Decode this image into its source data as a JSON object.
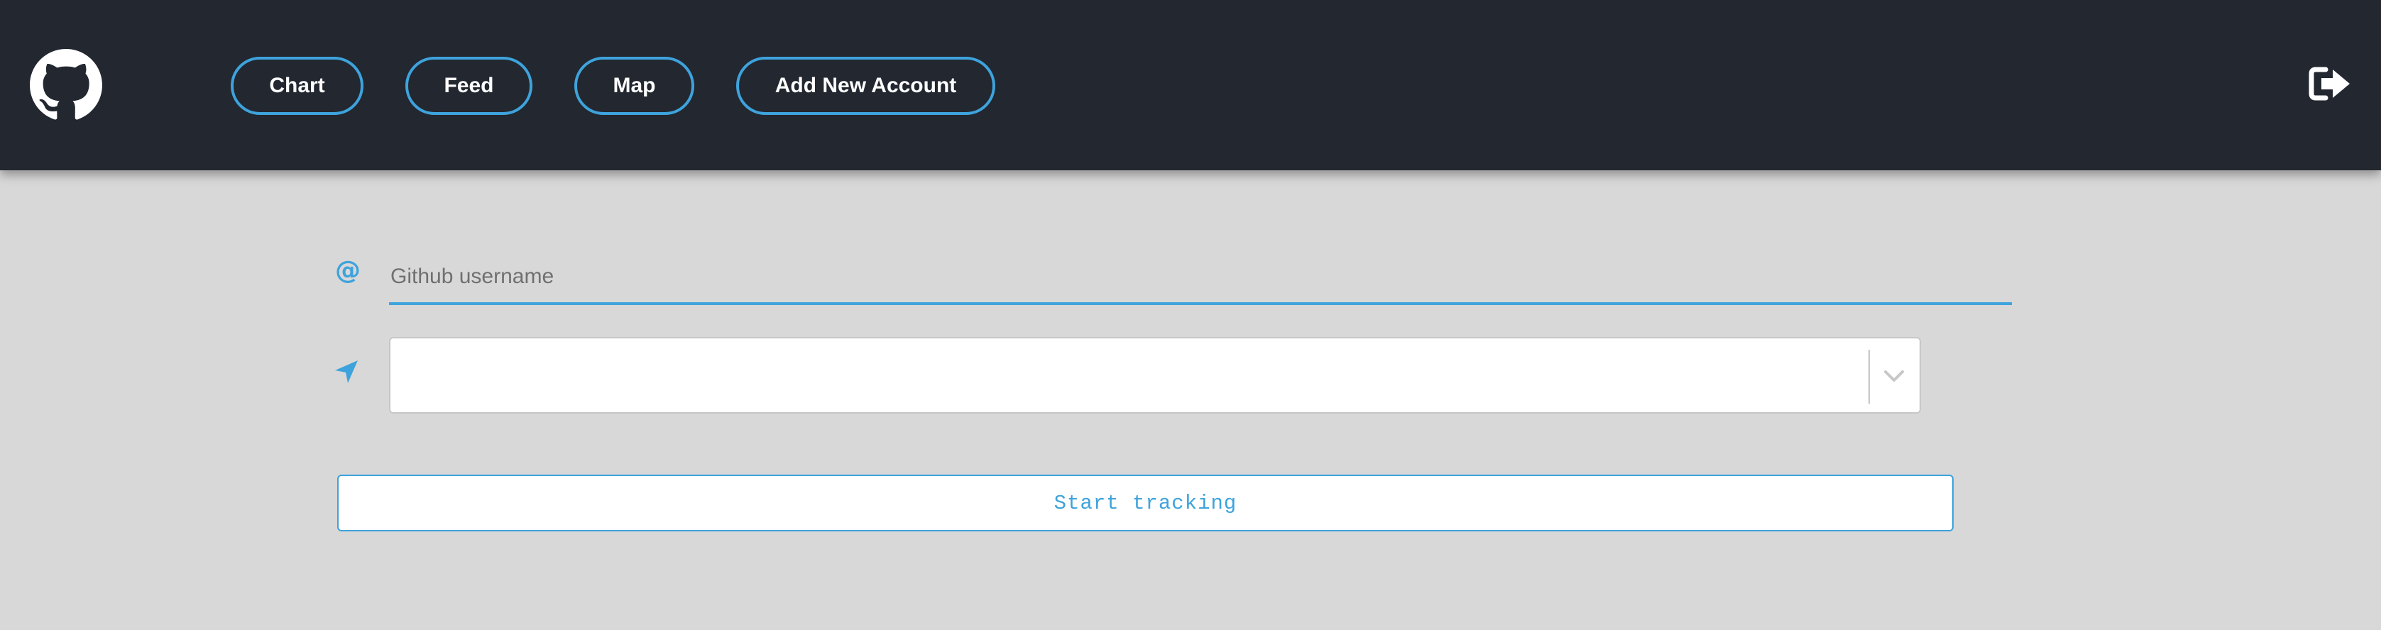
{
  "header": {
    "logo_icon": "github-icon",
    "nav": [
      {
        "label": "Chart"
      },
      {
        "label": "Feed"
      },
      {
        "label": "Map"
      },
      {
        "label": "Add New Account"
      }
    ],
    "logout_icon": "sign-out-icon"
  },
  "form": {
    "username_icon": "at-icon",
    "username_placeholder": "Github username",
    "username_value": "",
    "location_icon": "location-arrow-icon",
    "location_value": "",
    "dropdown_icon": "chevron-down-icon",
    "submit_label": "Start tracking"
  },
  "colors": {
    "header_bg": "#222730",
    "accent": "#3ea3dc",
    "page_bg": "#d8d8d8"
  }
}
